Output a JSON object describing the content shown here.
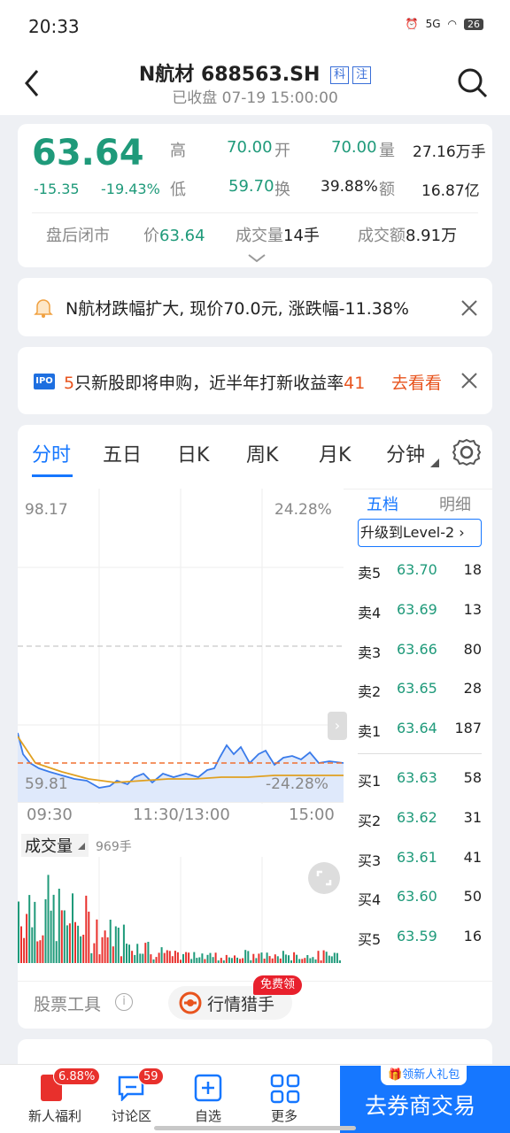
{
  "status": {
    "time": "20:33",
    "battery": "26",
    "signal": "5G"
  },
  "header": {
    "title": "N航材 688563.SH",
    "tag1": "科",
    "tag2": "注",
    "subtitle": "已收盘 07-19 15:00:00"
  },
  "quote": {
    "price": "63.64",
    "change": "-15.35",
    "change_pct": "-19.43%",
    "high_label": "高",
    "high": "70.00",
    "open_label": "开",
    "open": "70.00",
    "vol_label": "量",
    "vol": "27.16万手",
    "low_label": "低",
    "low": "59.70",
    "turnover_label": "换",
    "turnover": "39.88%",
    "amount_label": "额",
    "amount": "16.87亿",
    "after_label": "盘后闭市",
    "after_price_label": "价",
    "after_price": "63.64",
    "after_vol_label": "成交量",
    "after_vol": "14手",
    "after_amt_label": "成交额",
    "after_amt": "8.91万"
  },
  "alert": {
    "text": "N航材跌幅扩大, 现价70.0元, 涨跌幅-11.38%"
  },
  "ipo": {
    "badge": "IPO",
    "count": "5",
    "text": "只新股即将申购，近半年打新收益率",
    "rate": "41",
    "link": "去看看"
  },
  "tabs": [
    "分时",
    "五日",
    "日K",
    "周K",
    "月K",
    "分钟"
  ],
  "chart_labels": {
    "top_price": "98.17",
    "top_pct": "24.28%",
    "bottom_price": "59.81",
    "bottom_pct": "-24.28%",
    "t1": "09:30",
    "t2": "11:30/13:00",
    "t3": "15:00",
    "vol_title": "成交量",
    "vol_value": "969手"
  },
  "orderbook": {
    "tab1": "五档",
    "tab2": "明细",
    "upgrade": "升级到Level-2",
    "sells": [
      {
        "label": "卖5",
        "price": "63.70",
        "qty": "18"
      },
      {
        "label": "卖4",
        "price": "63.69",
        "qty": "13"
      },
      {
        "label": "卖3",
        "price": "63.66",
        "qty": "80"
      },
      {
        "label": "卖2",
        "price": "63.65",
        "qty": "28"
      },
      {
        "label": "卖1",
        "price": "63.64",
        "qty": "187"
      }
    ],
    "buys": [
      {
        "label": "买1",
        "price": "63.63",
        "qty": "58"
      },
      {
        "label": "买2",
        "price": "63.62",
        "qty": "31"
      },
      {
        "label": "买3",
        "price": "63.61",
        "qty": "41"
      },
      {
        "label": "买4",
        "price": "63.60",
        "qty": "50"
      },
      {
        "label": "买5",
        "price": "63.59",
        "qty": "16"
      }
    ]
  },
  "tools": {
    "label": "股票工具",
    "hunter": "行情猎手",
    "free": "免费领"
  },
  "bottom": {
    "benefit": "新人福利",
    "benefit_badge": "6.88%",
    "discuss": "讨论区",
    "discuss_badge": "59",
    "watch": "自选",
    "more": "更多",
    "trade": "去券商交易",
    "gift": "领新人礼包"
  },
  "colors": {
    "accent": "#1f9a7a",
    "brand": "#1677ff",
    "alert": "#e8541e"
  }
}
